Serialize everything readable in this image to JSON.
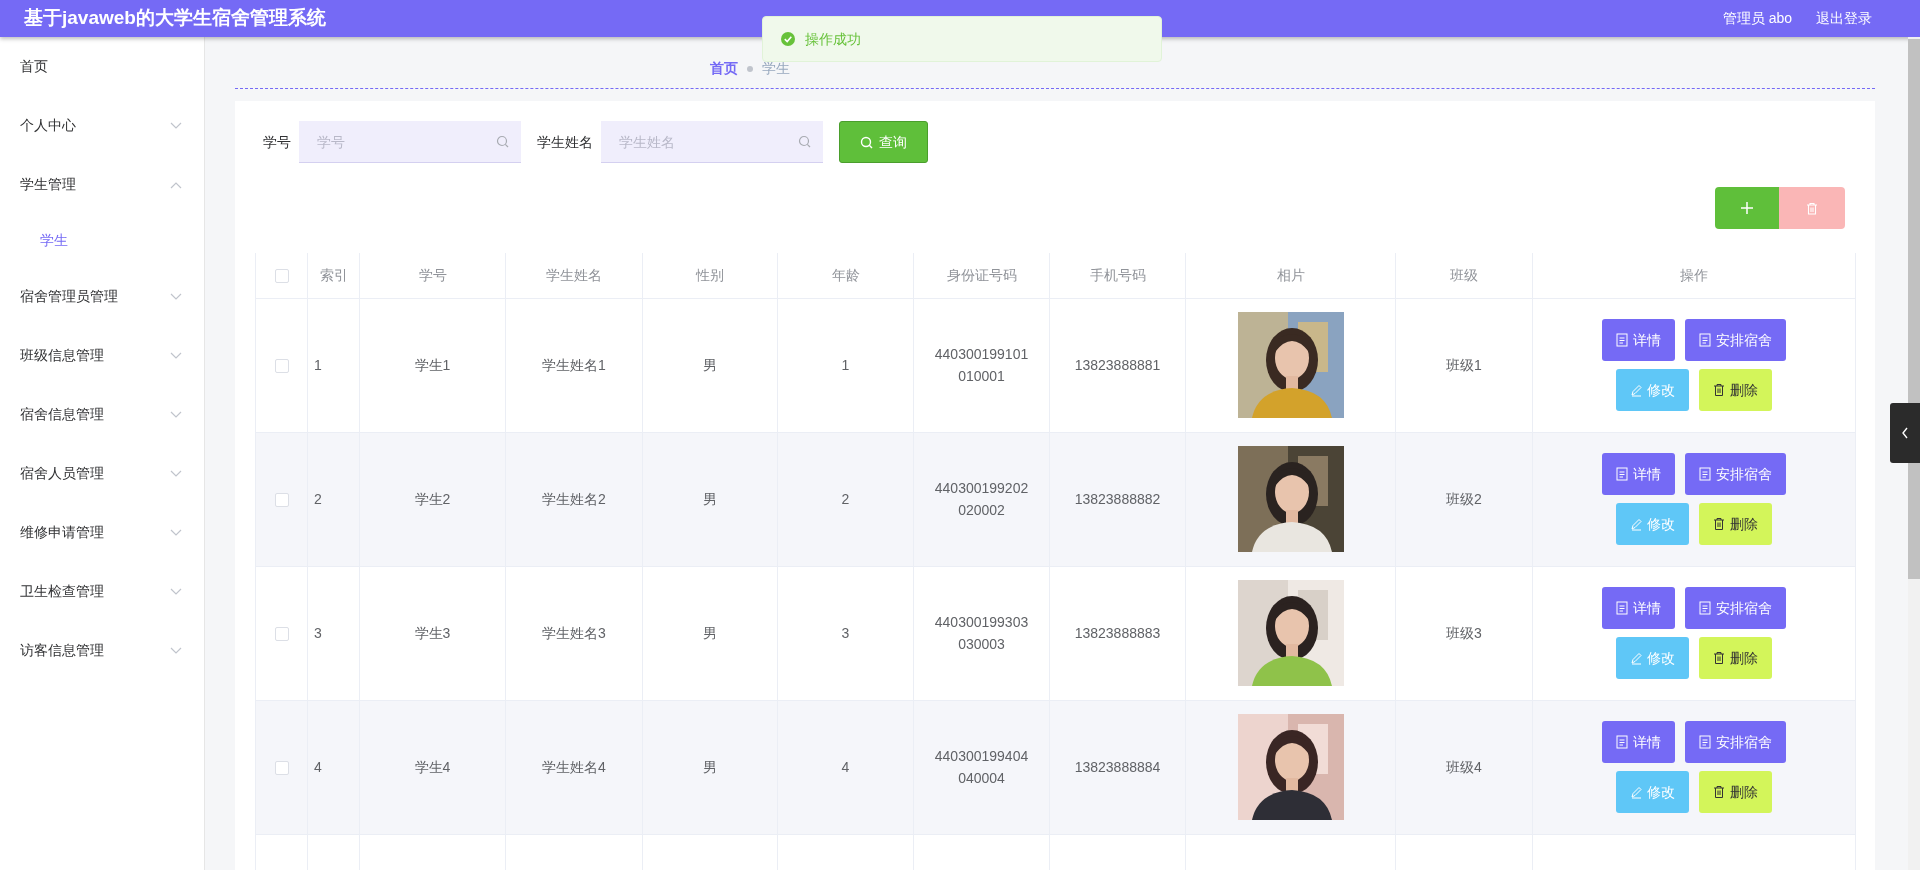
{
  "header": {
    "title": "基于javaweb的大学生宿舍管理系统",
    "user": "管理员 abo",
    "logout": "退出登录"
  },
  "toast": {
    "message": "操作成功"
  },
  "sidebar": {
    "items": [
      {
        "label": "首页",
        "kind": "link"
      },
      {
        "label": "个人中心",
        "kind": "menu",
        "expanded": false
      },
      {
        "label": "学生管理",
        "kind": "menu",
        "expanded": true,
        "children": [
          {
            "label": "学生",
            "selected": true
          }
        ]
      },
      {
        "label": "宿舍管理员管理",
        "kind": "menu",
        "expanded": false
      },
      {
        "label": "班级信息管理",
        "kind": "menu",
        "expanded": false
      },
      {
        "label": "宿舍信息管理",
        "kind": "menu",
        "expanded": false
      },
      {
        "label": "宿舍人员管理",
        "kind": "menu",
        "expanded": false
      },
      {
        "label": "维修申请管理",
        "kind": "menu",
        "expanded": false
      },
      {
        "label": "卫生检查管理",
        "kind": "menu",
        "expanded": false
      },
      {
        "label": "访客信息管理",
        "kind": "menu",
        "expanded": false
      }
    ]
  },
  "breadcrumb": [
    "首页",
    "学生"
  ],
  "search": {
    "fields": [
      {
        "label": "学号",
        "placeholder": "学号"
      },
      {
        "label": "学生姓名",
        "placeholder": "学生姓名"
      }
    ],
    "button": "查询"
  },
  "toolbar": {
    "add_disabled": false,
    "delete_disabled": true
  },
  "table": {
    "select_all_checked": false,
    "columns": [
      "索引",
      "学号",
      "学生姓名",
      "性别",
      "年龄",
      "身份证号码",
      "手机号码",
      "相片",
      "班级",
      "操作"
    ],
    "rows": [
      {
        "checked": false,
        "index": "1",
        "student_no": "学生1",
        "name": "学生姓名1",
        "gender": "男",
        "age": "1",
        "id_number": "440300199101010001",
        "phone": "13823888881",
        "class": "班级1",
        "actions": [
          {
            "kind": "detail",
            "label": "详情"
          },
          {
            "kind": "assign",
            "label": "安排宿舍"
          },
          {
            "kind": "edit",
            "label": "修改"
          },
          {
            "kind": "delete",
            "label": "删除"
          }
        ]
      },
      {
        "checked": false,
        "index": "2",
        "student_no": "学生2",
        "name": "学生姓名2",
        "gender": "男",
        "age": "2",
        "id_number": "440300199202020002",
        "phone": "13823888882",
        "class": "班级2",
        "actions": [
          {
            "kind": "detail",
            "label": "详情"
          },
          {
            "kind": "assign",
            "label": "安排宿舍"
          },
          {
            "kind": "edit",
            "label": "修改"
          },
          {
            "kind": "delete",
            "label": "删除"
          }
        ]
      },
      {
        "checked": false,
        "index": "3",
        "student_no": "学生3",
        "name": "学生姓名3",
        "gender": "男",
        "age": "3",
        "id_number": "440300199303030003",
        "phone": "13823888883",
        "class": "班级3",
        "actions": [
          {
            "kind": "detail",
            "label": "详情"
          },
          {
            "kind": "assign",
            "label": "安排宿舍"
          },
          {
            "kind": "edit",
            "label": "修改"
          },
          {
            "kind": "delete",
            "label": "删除"
          }
        ]
      },
      {
        "checked": false,
        "index": "4",
        "student_no": "学生4",
        "name": "学生姓名4",
        "gender": "男",
        "age": "4",
        "id_number": "440300199404040004",
        "phone": "13823888884",
        "class": "班级4",
        "actions": [
          {
            "kind": "detail",
            "label": "详情"
          },
          {
            "kind": "assign",
            "label": "安排宿舍"
          },
          {
            "kind": "edit",
            "label": "修改"
          },
          {
            "kind": "delete",
            "label": "删除"
          }
        ]
      }
    ]
  }
}
